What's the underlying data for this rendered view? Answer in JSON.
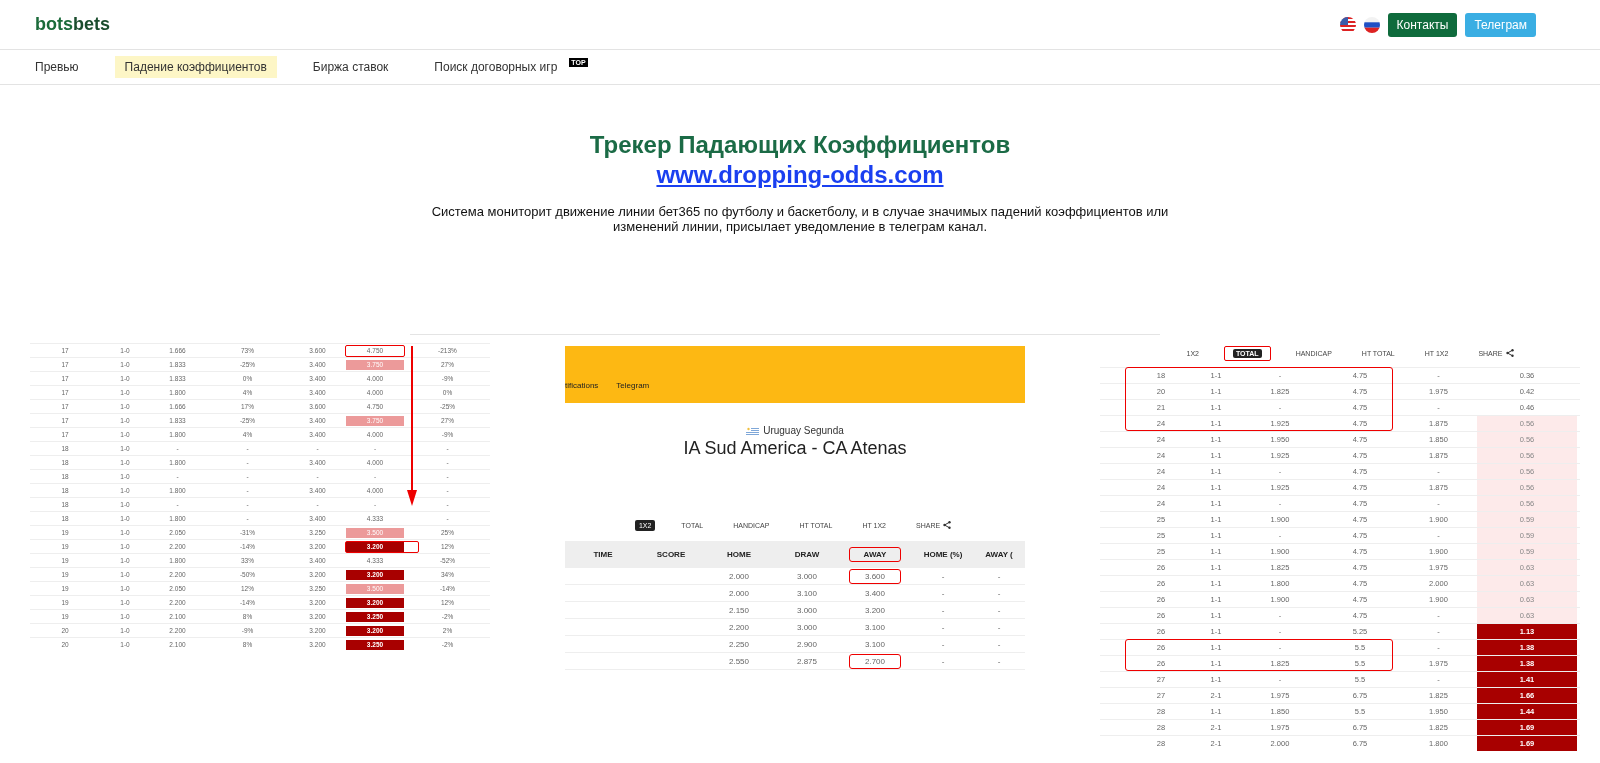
{
  "header": {
    "logo": {
      "first": "bots",
      "second": "bets"
    },
    "buttons": [
      {
        "label": "Контакты",
        "kind": "primary"
      },
      {
        "label": "Телеграм",
        "kind": "secondary"
      }
    ]
  },
  "nav": [
    {
      "label": "Превью",
      "selected": false
    },
    {
      "label": "Падение коэффициентов",
      "selected": true
    },
    {
      "label": "Биржа ставок",
      "selected": false
    },
    {
      "label": "Поиск договорных игр",
      "selected": false,
      "badge": "TOP"
    }
  ],
  "hero": {
    "title": "Трекер Падающих Коэффициентов",
    "link": "www.dropping-odds.com",
    "description": "Система мониторит движение линии бет365 по футболу и баскетболу, и в случае значимых падений коэффициентов или изменений линии, присылает уведомление в телеграм канал."
  },
  "left_table": {
    "rows": [
      {
        "cells": [
          "17",
          "1-0",
          "1.666",
          "73%",
          "3.600",
          "4.750",
          "-213%"
        ],
        "outlined": true
      },
      {
        "cells": [
          "17",
          "1-0",
          "1.833",
          "-25%",
          "3.400",
          "3.750",
          "27%"
        ],
        "color": "#ec9a9a",
        "outlined": false
      },
      {
        "cells": [
          "17",
          "1-0",
          "1.833",
          "0%",
          "3.400",
          "4.000",
          "-9%"
        ],
        "outlined": false
      },
      {
        "cells": [
          "17",
          "1-0",
          "1.800",
          "4%",
          "3.400",
          "4.000",
          "0%"
        ],
        "outlined": false
      },
      {
        "cells": [
          "17",
          "1-0",
          "1.666",
          "17%",
          "3.600",
          "4.750",
          "-25%"
        ],
        "outlined": false
      },
      {
        "cells": [
          "17",
          "1-0",
          "1.833",
          "-25%",
          "3.400",
          "3.750",
          "27%"
        ],
        "color": "#ec9a9a",
        "outlined": false
      },
      {
        "cells": [
          "17",
          "1-0",
          "1.800",
          "4%",
          "3.400",
          "4.000",
          "-9%"
        ],
        "outlined": false
      },
      {
        "cells": [
          "18",
          "1-0",
          "-",
          "-",
          "-",
          "-",
          "-"
        ],
        "outlined": false
      },
      {
        "cells": [
          "18",
          "1-0",
          "1.800",
          "-",
          "3.400",
          "4.000",
          "-"
        ],
        "outlined": false
      },
      {
        "cells": [
          "18",
          "1-0",
          "-",
          "-",
          "-",
          "-",
          "-"
        ],
        "outlined": false
      },
      {
        "cells": [
          "18",
          "1-0",
          "1.800",
          "-",
          "3.400",
          "4.000",
          "-"
        ],
        "outlined": false
      },
      {
        "cells": [
          "18",
          "1-0",
          "-",
          "-",
          "-",
          "-",
          "-"
        ],
        "outlined": false
      },
      {
        "cells": [
          "18",
          "1-0",
          "1.800",
          "-",
          "3.400",
          "4.333",
          "-"
        ],
        "outlined": false
      },
      {
        "cells": [
          "19",
          "1-0",
          "2.050",
          "-31%",
          "3.250",
          "3.500",
          "25%"
        ],
        "color": "#ec9a9a",
        "outlined": false
      },
      {
        "cells": [
          "19",
          "1-0",
          "2.200",
          "-14%",
          "3.200",
          "3.200",
          "12%"
        ],
        "color": "#a80000",
        "outlined": true
      },
      {
        "cells": [
          "19",
          "1-0",
          "1.800",
          "33%",
          "3.400",
          "4.333",
          "-52%"
        ],
        "outlined": false
      },
      {
        "cells": [
          "19",
          "1-0",
          "2.200",
          "-50%",
          "3.200",
          "3.200",
          "34%"
        ],
        "color": "#a80000",
        "outlined": false
      },
      {
        "cells": [
          "19",
          "1-0",
          "2.050",
          "12%",
          "3.250",
          "3.500",
          "-14%"
        ],
        "color": "#ec9a9a",
        "outlined": false
      },
      {
        "cells": [
          "19",
          "1-0",
          "2.200",
          "-14%",
          "3.200",
          "3.200",
          "12%"
        ],
        "color": "#a80000",
        "outlined": false
      },
      {
        "cells": [
          "19",
          "1-0",
          "2.100",
          "8%",
          "3.200",
          "3.250",
          "-2%"
        ],
        "color": "#a80000",
        "outlined": false
      },
      {
        "cells": [
          "20",
          "1-0",
          "2.200",
          "-9%",
          "3.200",
          "3.200",
          "2%"
        ],
        "color": "#a80000",
        "outlined": false
      },
      {
        "cells": [
          "20",
          "1-0",
          "2.100",
          "8%",
          "3.200",
          "3.250",
          "-2%"
        ],
        "color": "#a80000",
        "outlined": false
      }
    ]
  },
  "match_screenshot": {
    "nav": [
      "tifications",
      "Telegram"
    ],
    "league": "Uruguay Segunda",
    "match": "IA Sud America - CA Atenas",
    "tabs": [
      {
        "label": "1X2",
        "selected": true
      },
      {
        "label": "TOTAL",
        "selected": false
      },
      {
        "label": "HANDICAP",
        "selected": false
      },
      {
        "label": "HT TOTAL",
        "selected": false
      },
      {
        "label": "HT 1X2",
        "selected": false
      }
    ],
    "share": "SHARE",
    "columns": [
      {
        "label": "TIME",
        "outlined": false
      },
      {
        "label": "SCORE",
        "outlined": false
      },
      {
        "label": "HOME",
        "outlined": false
      },
      {
        "label": "DRAW",
        "outlined": false
      },
      {
        "label": "AWAY",
        "outlined": true
      },
      {
        "label": "HOME (%)",
        "outlined": false
      },
      {
        "label": "AWAY (",
        "outlined": false
      }
    ],
    "rows": [
      {
        "home": "2.000",
        "draw": "3.000",
        "away": "3.600",
        "home_pct": "-",
        "away_pct": "-",
        "away_outlined": true
      },
      {
        "home": "2.000",
        "draw": "3.100",
        "away": "3.400",
        "home_pct": "-",
        "away_pct": "-",
        "away_outlined": false
      },
      {
        "home": "2.150",
        "draw": "3.000",
        "away": "3.200",
        "home_pct": "-",
        "away_pct": "-",
        "away_outlined": false
      },
      {
        "home": "2.200",
        "draw": "3.000",
        "away": "3.100",
        "home_pct": "-",
        "away_pct": "-",
        "away_outlined": false
      },
      {
        "home": "2.250",
        "draw": "2.900",
        "away": "3.100",
        "home_pct": "-",
        "away_pct": "-",
        "away_outlined": false
      },
      {
        "home": "2.550",
        "draw": "2.875",
        "away": "2.700",
        "home_pct": "-",
        "away_pct": "-",
        "away_outlined": true
      }
    ]
  },
  "total_screenshot": {
    "tabs": [
      {
        "label": "1X2",
        "selected": false,
        "outlined": false
      },
      {
        "label": "TOTAL",
        "selected": true,
        "outlined": true
      },
      {
        "label": "HANDICAP",
        "selected": false,
        "outlined": false
      },
      {
        "label": "HT TOTAL",
        "selected": false,
        "outlined": false
      },
      {
        "label": "HT 1X2",
        "selected": false,
        "outlined": false
      }
    ],
    "share": "SHARE",
    "rows": [
      {
        "cells": [
          "18",
          "1-1",
          "-",
          "4.75",
          "-",
          "0.36"
        ],
        "boxed": true
      },
      {
        "cells": [
          "20",
          "1-1",
          "1.825",
          "4.75",
          "1.975",
          "0.42"
        ],
        "boxed": true
      },
      {
        "cells": [
          "21",
          "1-1",
          "-",
          "4.75",
          "-",
          "0.46"
        ],
        "boxed": true
      },
      {
        "cells": [
          "24",
          "1-1",
          "1.925",
          "4.75",
          "1.875",
          "0.56"
        ],
        "color": "#fdeaea",
        "boxed": true
      },
      {
        "cells": [
          "24",
          "1-1",
          "1.950",
          "4.75",
          "1.850",
          "0.56"
        ],
        "color": "#fdeaea",
        "boxed": false
      },
      {
        "cells": [
          "24",
          "1-1",
          "1.925",
          "4.75",
          "1.875",
          "0.56"
        ],
        "color": "#fdeaea",
        "boxed": false
      },
      {
        "cells": [
          "24",
          "1-1",
          "-",
          "4.75",
          "-",
          "0.56"
        ],
        "color": "#fdeaea",
        "boxed": false
      },
      {
        "cells": [
          "24",
          "1-1",
          "1.925",
          "4.75",
          "1.875",
          "0.56"
        ],
        "color": "#fdeaea",
        "boxed": false
      },
      {
        "cells": [
          "24",
          "1-1",
          "-",
          "4.75",
          "-",
          "0.56"
        ],
        "color": "#fdeaea",
        "boxed": false
      },
      {
        "cells": [
          "25",
          "1-1",
          "1.900",
          "4.75",
          "1.900",
          "0.59"
        ],
        "color": "#fdeaea",
        "boxed": false
      },
      {
        "cells": [
          "25",
          "1-1",
          "-",
          "4.75",
          "-",
          "0.59"
        ],
        "color": "#fdeaea",
        "boxed": false
      },
      {
        "cells": [
          "25",
          "1-1",
          "1.900",
          "4.75",
          "1.900",
          "0.59"
        ],
        "color": "#fdeaea",
        "boxed": false
      },
      {
        "cells": [
          "26",
          "1-1",
          "1.825",
          "4.75",
          "1.975",
          "0.63"
        ],
        "color": "#fdeaea",
        "boxed": false
      },
      {
        "cells": [
          "26",
          "1-1",
          "1.800",
          "4.75",
          "2.000",
          "0.63"
        ],
        "color": "#fdeaea",
        "boxed": false
      },
      {
        "cells": [
          "26",
          "1-1",
          "1.900",
          "4.75",
          "1.900",
          "0.63"
        ],
        "color": "#fdeaea",
        "boxed": false
      },
      {
        "cells": [
          "26",
          "1-1",
          "-",
          "4.75",
          "-",
          "0.63"
        ],
        "color": "#fdeaea",
        "boxed": false
      },
      {
        "cells": [
          "26",
          "1-1",
          "-",
          "5.25",
          "-",
          "1.13"
        ],
        "color": "#a80000",
        "boxed": false
      },
      {
        "cells": [
          "26",
          "1-1",
          "-",
          "5.5",
          "-",
          "1.38"
        ],
        "color": "#a80000",
        "boxed": true
      },
      {
        "cells": [
          "26",
          "1-1",
          "1.825",
          "5.5",
          "1.975",
          "1.38"
        ],
        "color": "#a80000",
        "boxed": true
      },
      {
        "cells": [
          "27",
          "1-1",
          "-",
          "5.5",
          "-",
          "1.41"
        ],
        "color": "#a80000",
        "boxed": false
      },
      {
        "cells": [
          "27",
          "2-1",
          "1.975",
          "6.75",
          "1.825",
          "1.66"
        ],
        "color": "#a80000",
        "boxed": false
      },
      {
        "cells": [
          "28",
          "1-1",
          "1.850",
          "5.5",
          "1.950",
          "1.44"
        ],
        "color": "#a80000",
        "boxed": false
      },
      {
        "cells": [
          "28",
          "2-1",
          "1.975",
          "6.75",
          "1.825",
          "1.69"
        ],
        "color": "#a80000",
        "boxed": false
      },
      {
        "cells": [
          "28",
          "2-1",
          "2.000",
          "6.75",
          "1.800",
          "1.69"
        ],
        "color": "#a80000",
        "boxed": false
      }
    ]
  }
}
